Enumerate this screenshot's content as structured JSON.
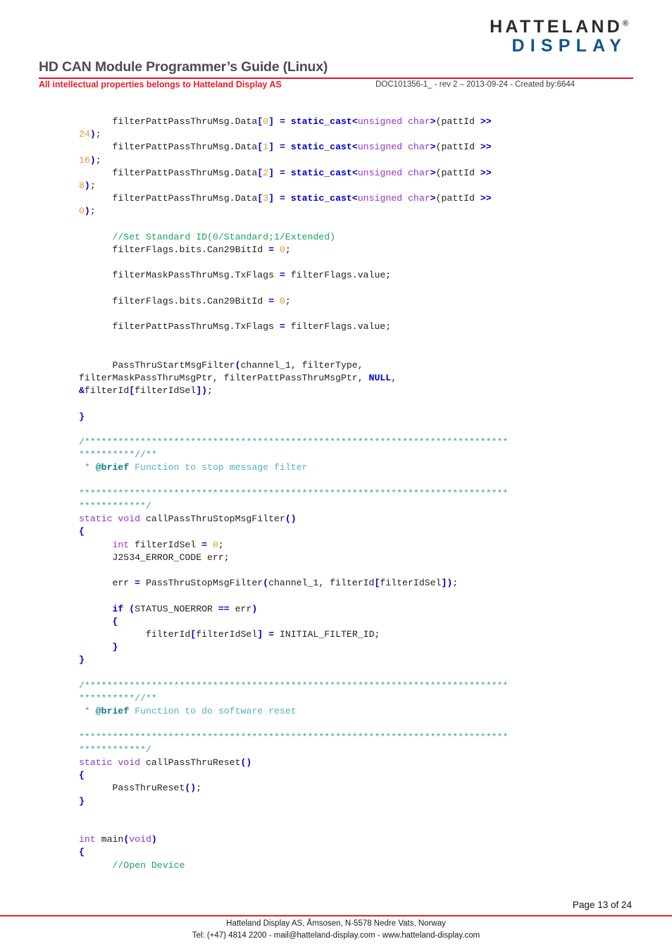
{
  "header": {
    "logo_line1": "HATTELAND",
    "logo_registered": "®",
    "logo_line2": "DISPLAY",
    "title": "HD CAN Module Programmer’s Guide (Linux)",
    "subtitle": "All intellectual properties  belongs to Hatteland Display AS",
    "doc_info": "DOC101356-1_ - rev 2 – 2013-09-24 - Created by:6644",
    "accent_red": "#ee1c25",
    "logo_blue": "#12558f"
  },
  "code": {
    "language": "C++",
    "colors": {
      "keyword": "#9933cc",
      "keyword_bold": "#0000cc",
      "punctuation": "#0000cc",
      "number": "#e8962a",
      "line_comment": "#1aa35a",
      "block_comment": "#3aa0a8",
      "brief_tag": "#0b7b84",
      "plain": "#202020"
    },
    "lines": [
      {
        "id": "l01",
        "tokens": [
          {
            "t": "      filterPattPassThruMsg.Data",
            "c": "t-plain"
          },
          {
            "t": "[",
            "c": "t-punc"
          },
          {
            "t": "0",
            "c": "t-num"
          },
          {
            "t": "]",
            "c": "t-punc"
          },
          {
            "t": " ",
            "c": "t-plain"
          },
          {
            "t": "=",
            "c": "t-punc"
          },
          {
            "t": " ",
            "c": "t-plain"
          },
          {
            "t": "static_cast",
            "c": "t-kwb"
          },
          {
            "t": "<",
            "c": "t-punc"
          },
          {
            "t": "unsigned char",
            "c": "t-kw"
          },
          {
            "t": ">",
            "c": "t-punc"
          },
          {
            "t": "(pattId ",
            "c": "t-plain"
          },
          {
            "t": ">>",
            "c": "t-punc"
          }
        ]
      },
      {
        "id": "l02",
        "tokens": [
          {
            "t": "24",
            "c": "t-num"
          },
          {
            "t": ")",
            "c": "t-punc"
          },
          {
            "t": ";",
            "c": "t-plain"
          }
        ]
      },
      {
        "id": "l03",
        "tokens": [
          {
            "t": "      filterPattPassThruMsg.Data",
            "c": "t-plain"
          },
          {
            "t": "[",
            "c": "t-punc"
          },
          {
            "t": "1",
            "c": "t-num"
          },
          {
            "t": "]",
            "c": "t-punc"
          },
          {
            "t": " ",
            "c": "t-plain"
          },
          {
            "t": "=",
            "c": "t-punc"
          },
          {
            "t": " ",
            "c": "t-plain"
          },
          {
            "t": "static_cast",
            "c": "t-kwb"
          },
          {
            "t": "<",
            "c": "t-punc"
          },
          {
            "t": "unsigned char",
            "c": "t-kw"
          },
          {
            "t": ">",
            "c": "t-punc"
          },
          {
            "t": "(pattId ",
            "c": "t-plain"
          },
          {
            "t": ">>",
            "c": "t-punc"
          }
        ]
      },
      {
        "id": "l04",
        "tokens": [
          {
            "t": "16",
            "c": "t-num"
          },
          {
            "t": ")",
            "c": "t-punc"
          },
          {
            "t": ";",
            "c": "t-plain"
          }
        ]
      },
      {
        "id": "l05",
        "tokens": [
          {
            "t": "      filterPattPassThruMsg.Data",
            "c": "t-plain"
          },
          {
            "t": "[",
            "c": "t-punc"
          },
          {
            "t": "2",
            "c": "t-num"
          },
          {
            "t": "]",
            "c": "t-punc"
          },
          {
            "t": " ",
            "c": "t-plain"
          },
          {
            "t": "=",
            "c": "t-punc"
          },
          {
            "t": " ",
            "c": "t-plain"
          },
          {
            "t": "static_cast",
            "c": "t-kwb"
          },
          {
            "t": "<",
            "c": "t-punc"
          },
          {
            "t": "unsigned char",
            "c": "t-kw"
          },
          {
            "t": ">",
            "c": "t-punc"
          },
          {
            "t": "(pattId ",
            "c": "t-plain"
          },
          {
            "t": ">>",
            "c": "t-punc"
          }
        ]
      },
      {
        "id": "l06",
        "tokens": [
          {
            "t": "8",
            "c": "t-num"
          },
          {
            "t": ")",
            "c": "t-punc"
          },
          {
            "t": ";",
            "c": "t-plain"
          }
        ]
      },
      {
        "id": "l07",
        "tokens": [
          {
            "t": "      filterPattPassThruMsg.Data",
            "c": "t-plain"
          },
          {
            "t": "[",
            "c": "t-punc"
          },
          {
            "t": "3",
            "c": "t-num"
          },
          {
            "t": "]",
            "c": "t-punc"
          },
          {
            "t": " ",
            "c": "t-plain"
          },
          {
            "t": "=",
            "c": "t-punc"
          },
          {
            "t": " ",
            "c": "t-plain"
          },
          {
            "t": "static_cast",
            "c": "t-kwb"
          },
          {
            "t": "<",
            "c": "t-punc"
          },
          {
            "t": "unsigned char",
            "c": "t-kw"
          },
          {
            "t": ">",
            "c": "t-punc"
          },
          {
            "t": "(pattId ",
            "c": "t-plain"
          },
          {
            "t": ">>",
            "c": "t-punc"
          }
        ]
      },
      {
        "id": "l08",
        "tokens": [
          {
            "t": "0",
            "c": "t-num"
          },
          {
            "t": ")",
            "c": "t-punc"
          },
          {
            "t": ";",
            "c": "t-plain"
          }
        ]
      },
      {
        "id": "l09",
        "tokens": []
      },
      {
        "id": "l10",
        "tokens": [
          {
            "t": "      //Set Standard ID(0/Standard;1/Extended)",
            "c": "t-cmt"
          }
        ]
      },
      {
        "id": "l11",
        "tokens": [
          {
            "t": "      filterFlags.bits.Can29BitId ",
            "c": "t-plain"
          },
          {
            "t": "=",
            "c": "t-punc"
          },
          {
            "t": " ",
            "c": "t-plain"
          },
          {
            "t": "0",
            "c": "t-num"
          },
          {
            "t": ";",
            "c": "t-plain"
          }
        ]
      },
      {
        "id": "l12",
        "tokens": []
      },
      {
        "id": "l13",
        "tokens": [
          {
            "t": "      filterMaskPassThruMsg.TxFlags ",
            "c": "t-plain"
          },
          {
            "t": "=",
            "c": "t-punc"
          },
          {
            "t": " filterFlags.value;",
            "c": "t-plain"
          }
        ]
      },
      {
        "id": "l14",
        "tokens": []
      },
      {
        "id": "l15",
        "tokens": [
          {
            "t": "      filterFlags.bits.Can29BitId ",
            "c": "t-plain"
          },
          {
            "t": "=",
            "c": "t-punc"
          },
          {
            "t": " ",
            "c": "t-plain"
          },
          {
            "t": "0",
            "c": "t-num"
          },
          {
            "t": ";",
            "c": "t-plain"
          }
        ]
      },
      {
        "id": "l16",
        "tokens": []
      },
      {
        "id": "l17",
        "tokens": [
          {
            "t": "      filterPattPassThruMsg.TxFlags ",
            "c": "t-plain"
          },
          {
            "t": "=",
            "c": "t-punc"
          },
          {
            "t": " filterFlags.value;",
            "c": "t-plain"
          }
        ]
      },
      {
        "id": "l18",
        "tokens": []
      },
      {
        "id": "l19",
        "tokens": []
      },
      {
        "id": "l20",
        "tokens": [
          {
            "t": "      PassThruStartMsgFilter",
            "c": "t-plain"
          },
          {
            "t": "(",
            "c": "t-punc"
          },
          {
            "t": "channel_1, filterType,",
            "c": "t-plain"
          }
        ]
      },
      {
        "id": "l21",
        "tokens": [
          {
            "t": "filterMaskPassThruMsgPtr, filterPattPassThruMsgPtr, ",
            "c": "t-plain"
          },
          {
            "t": "NULL",
            "c": "t-kwb"
          },
          {
            "t": ",",
            "c": "t-plain"
          }
        ]
      },
      {
        "id": "l22",
        "tokens": [
          {
            "t": "&",
            "c": "t-punc"
          },
          {
            "t": "filterId",
            "c": "t-plain"
          },
          {
            "t": "[",
            "c": "t-punc"
          },
          {
            "t": "filterIdSel",
            "c": "t-plain"
          },
          {
            "t": "])",
            "c": "t-punc"
          },
          {
            "t": ";",
            "c": "t-plain"
          }
        ]
      },
      {
        "id": "l23",
        "tokens": []
      },
      {
        "id": "l24",
        "tokens": [
          {
            "t": "}",
            "c": "t-punc"
          }
        ]
      },
      {
        "id": "l25",
        "tokens": []
      },
      {
        "id": "l26",
        "tokens": [
          {
            "t": "/****************************************************************************",
            "c": "t-bcmt"
          }
        ]
      },
      {
        "id": "l27",
        "tokens": [
          {
            "t": "**********//**",
            "c": "t-bcmt"
          }
        ]
      },
      {
        "id": "l28",
        "tokens": [
          {
            "t": " * ",
            "c": "t-bcmt"
          },
          {
            "t": "@brief",
            "c": "t-brief"
          },
          {
            "t": " Function to stop message filter",
            "c": "t-bcmt-txt"
          }
        ]
      },
      {
        "id": "l29",
        "tokens": []
      },
      {
        "id": "l30",
        "tokens": [
          {
            "t": "*****************************************************************************",
            "c": "t-bcmt"
          }
        ]
      },
      {
        "id": "l31",
        "tokens": [
          {
            "t": "************/",
            "c": "t-bcmt"
          }
        ]
      },
      {
        "id": "l32",
        "tokens": [
          {
            "t": "static void",
            "c": "t-kw"
          },
          {
            "t": " callPassThruStopMsgFilter",
            "c": "t-plain"
          },
          {
            "t": "()",
            "c": "t-punc"
          }
        ]
      },
      {
        "id": "l33",
        "tokens": [
          {
            "t": "{",
            "c": "t-punc"
          }
        ]
      },
      {
        "id": "l34",
        "tokens": [
          {
            "t": "      ",
            "c": "t-plain"
          },
          {
            "t": "int",
            "c": "t-kw"
          },
          {
            "t": " filterIdSel ",
            "c": "t-plain"
          },
          {
            "t": "=",
            "c": "t-punc"
          },
          {
            "t": " ",
            "c": "t-plain"
          },
          {
            "t": "0",
            "c": "t-num"
          },
          {
            "t": ";",
            "c": "t-plain"
          }
        ]
      },
      {
        "id": "l35",
        "tokens": [
          {
            "t": "      J2534_ERROR_CODE err;",
            "c": "t-plain"
          }
        ]
      },
      {
        "id": "l36",
        "tokens": []
      },
      {
        "id": "l37",
        "tokens": [
          {
            "t": "      err ",
            "c": "t-plain"
          },
          {
            "t": "=",
            "c": "t-punc"
          },
          {
            "t": " PassThruStopMsgFilter",
            "c": "t-plain"
          },
          {
            "t": "(",
            "c": "t-punc"
          },
          {
            "t": "channel_1, filterId",
            "c": "t-plain"
          },
          {
            "t": "[",
            "c": "t-punc"
          },
          {
            "t": "filterIdSel",
            "c": "t-plain"
          },
          {
            "t": "])",
            "c": "t-punc"
          },
          {
            "t": ";",
            "c": "t-plain"
          }
        ]
      },
      {
        "id": "l38",
        "tokens": []
      },
      {
        "id": "l39",
        "tokens": [
          {
            "t": "      ",
            "c": "t-plain"
          },
          {
            "t": "if",
            "c": "t-kwb"
          },
          {
            "t": " ",
            "c": "t-plain"
          },
          {
            "t": "(",
            "c": "t-punc"
          },
          {
            "t": "STATUS_NOERROR ",
            "c": "t-plain"
          },
          {
            "t": "==",
            "c": "t-punc"
          },
          {
            "t": " err",
            "c": "t-plain"
          },
          {
            "t": ")",
            "c": "t-punc"
          }
        ]
      },
      {
        "id": "l40",
        "tokens": [
          {
            "t": "      ",
            "c": "t-plain"
          },
          {
            "t": "{",
            "c": "t-punc"
          }
        ]
      },
      {
        "id": "l41",
        "tokens": [
          {
            "t": "            filterId",
            "c": "t-plain"
          },
          {
            "t": "[",
            "c": "t-punc"
          },
          {
            "t": "filterIdSel",
            "c": "t-plain"
          },
          {
            "t": "]",
            "c": "t-punc"
          },
          {
            "t": " ",
            "c": "t-plain"
          },
          {
            "t": "=",
            "c": "t-punc"
          },
          {
            "t": " INITIAL_FILTER_ID;",
            "c": "t-plain"
          }
        ]
      },
      {
        "id": "l42",
        "tokens": [
          {
            "t": "      ",
            "c": "t-plain"
          },
          {
            "t": "}",
            "c": "t-punc"
          }
        ]
      },
      {
        "id": "l43",
        "tokens": [
          {
            "t": "}",
            "c": "t-punc"
          }
        ]
      },
      {
        "id": "l44",
        "tokens": []
      },
      {
        "id": "l45",
        "tokens": [
          {
            "t": "/****************************************************************************",
            "c": "t-bcmt"
          }
        ]
      },
      {
        "id": "l46",
        "tokens": [
          {
            "t": "**********//**",
            "c": "t-bcmt"
          }
        ]
      },
      {
        "id": "l47",
        "tokens": [
          {
            "t": " * ",
            "c": "t-bcmt"
          },
          {
            "t": "@brief",
            "c": "t-brief"
          },
          {
            "t": " Function to do software reset",
            "c": "t-bcmt-txt"
          }
        ]
      },
      {
        "id": "l48",
        "tokens": []
      },
      {
        "id": "l49",
        "tokens": [
          {
            "t": "*****************************************************************************",
            "c": "t-bcmt"
          }
        ]
      },
      {
        "id": "l50",
        "tokens": [
          {
            "t": "************/",
            "c": "t-bcmt"
          }
        ]
      },
      {
        "id": "l51",
        "tokens": [
          {
            "t": "static void",
            "c": "t-kw"
          },
          {
            "t": " callPassThruReset",
            "c": "t-plain"
          },
          {
            "t": "()",
            "c": "t-punc"
          }
        ]
      },
      {
        "id": "l52",
        "tokens": [
          {
            "t": "{",
            "c": "t-punc"
          }
        ]
      },
      {
        "id": "l53",
        "tokens": [
          {
            "t": "      PassThruReset",
            "c": "t-plain"
          },
          {
            "t": "()",
            "c": "t-punc"
          },
          {
            "t": ";",
            "c": "t-plain"
          }
        ]
      },
      {
        "id": "l54",
        "tokens": [
          {
            "t": "}",
            "c": "t-punc"
          }
        ]
      },
      {
        "id": "l55",
        "tokens": []
      },
      {
        "id": "l56",
        "tokens": []
      },
      {
        "id": "l57",
        "tokens": [
          {
            "t": "int",
            "c": "t-kw"
          },
          {
            "t": " main",
            "c": "t-plain"
          },
          {
            "t": "(",
            "c": "t-punc"
          },
          {
            "t": "void",
            "c": "t-kw"
          },
          {
            "t": ")",
            "c": "t-punc"
          }
        ]
      },
      {
        "id": "l58",
        "tokens": [
          {
            "t": "{",
            "c": "t-punc"
          }
        ]
      },
      {
        "id": "l59",
        "tokens": [
          {
            "t": "      //Open Device",
            "c": "t-cmt"
          }
        ]
      }
    ]
  },
  "footer": {
    "page_number": "Page 13 of 24",
    "address_line": "Hatteland Display AS, Åmsosen, N-5578 Nedre Vats, Norway",
    "contact_line": "Tel: (+47) 4814 2200 - mail@hatteland-display.com - www.hatteland-display.com"
  }
}
